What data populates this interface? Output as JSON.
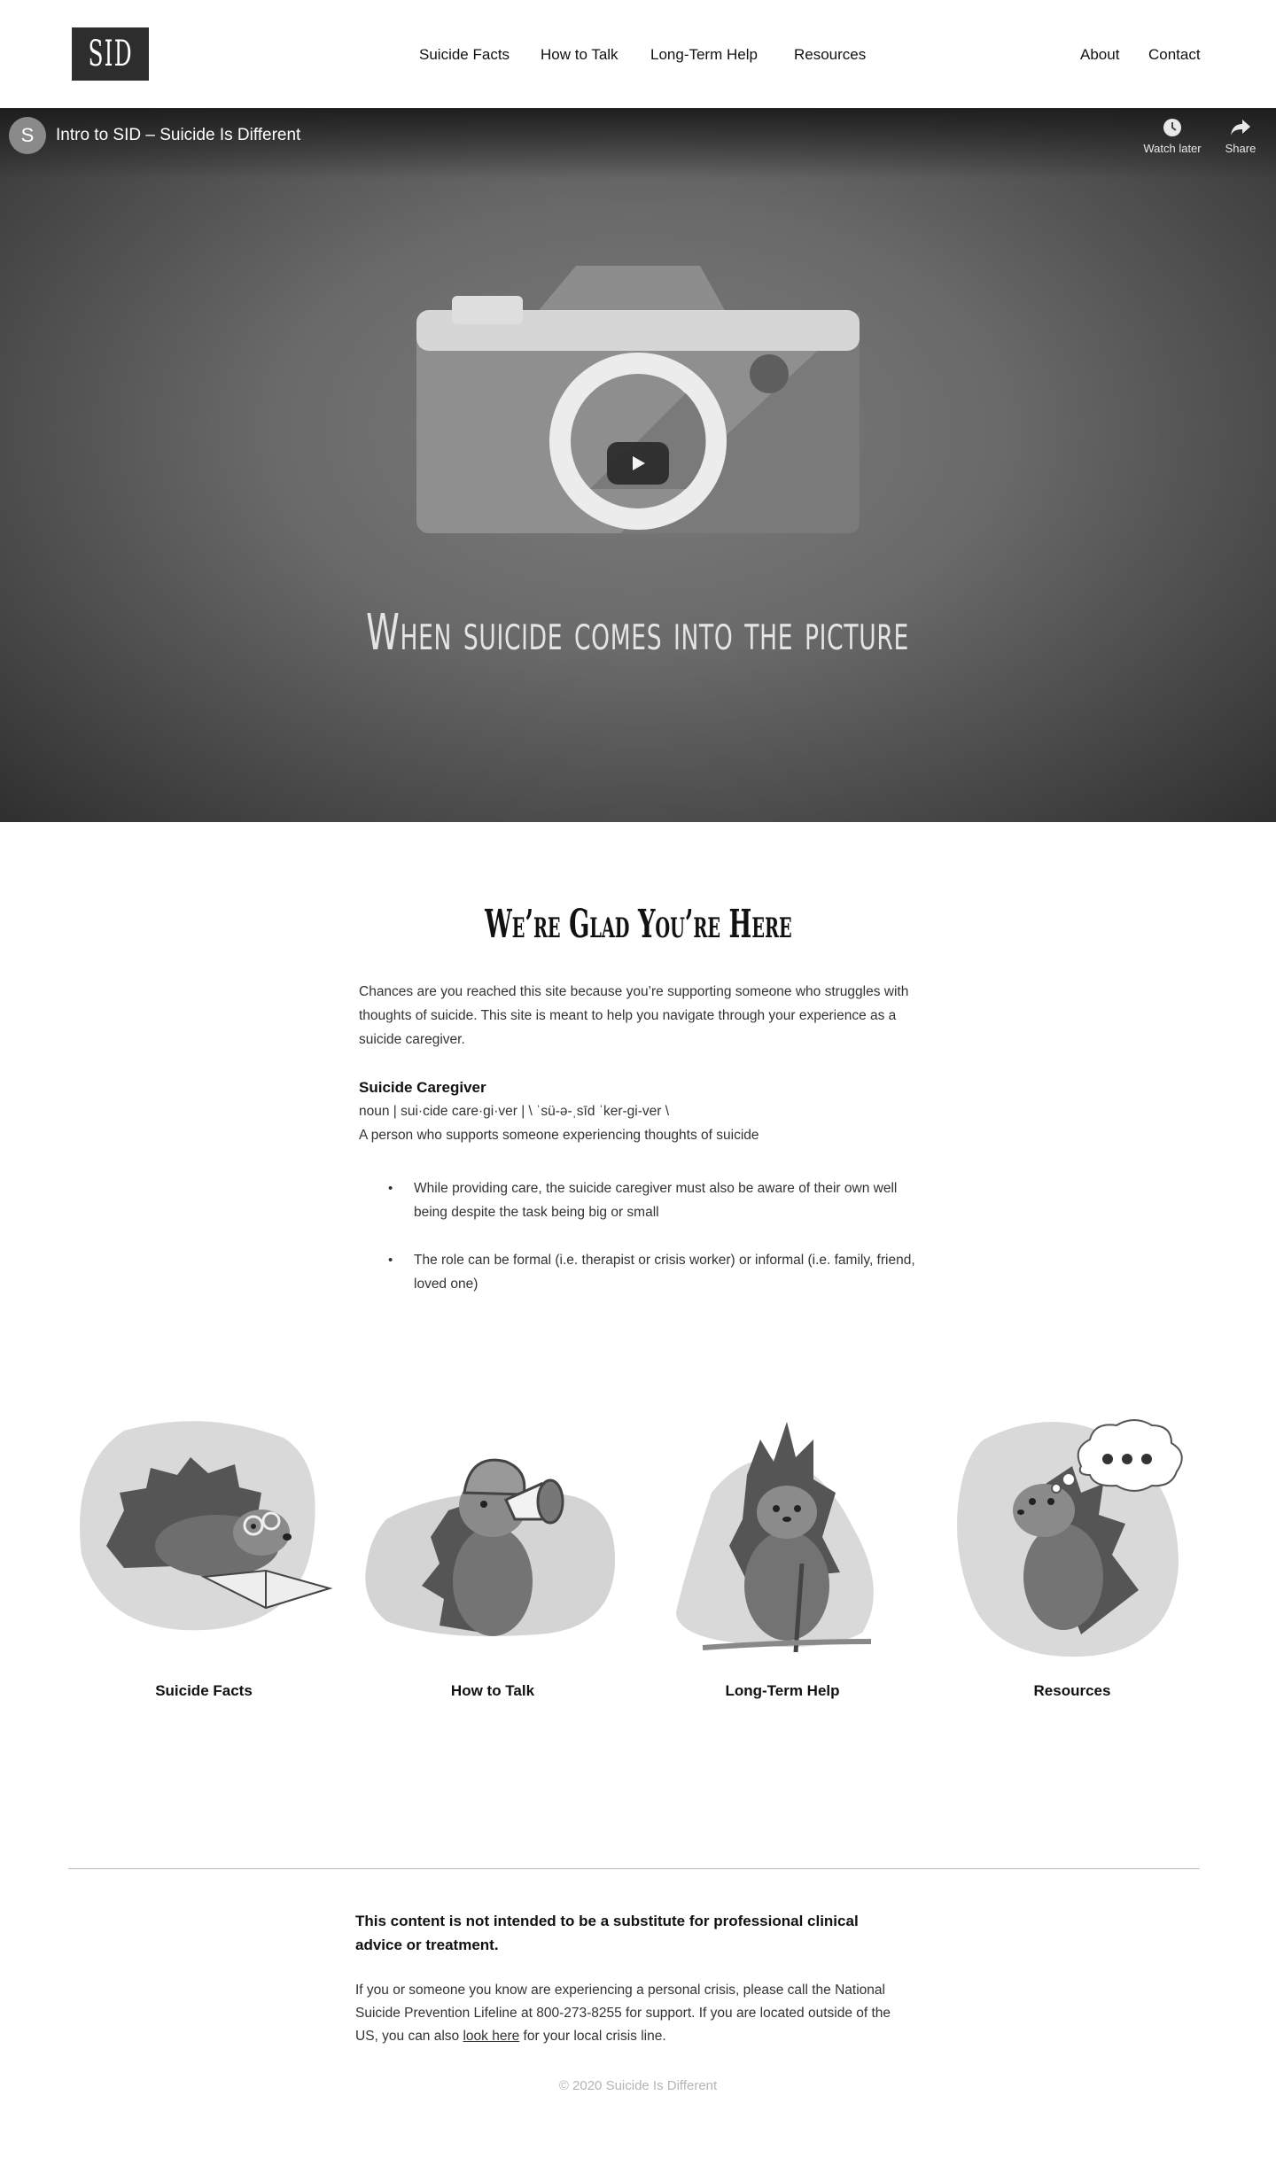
{
  "header": {
    "logo_text": "SID",
    "nav_main": [
      "Suicide Facts",
      "How to Talk",
      "Long-Term Help",
      "Resources"
    ],
    "nav_secondary": [
      "About",
      "Contact"
    ]
  },
  "video": {
    "channel_initial": "S",
    "title": "Intro to SID – Suicide Is Different",
    "watch_later_label": "Watch later",
    "share_label": "Share",
    "caption": "When suicide comes into the picture"
  },
  "intro": {
    "heading": "We’re Glad You’re Here",
    "paragraph": "Chances are you reached this site because you’re supporting someone who struggles with thoughts of suicide. This site is meant to help you navigate through your experience as a suicide caregiver.",
    "definition_term": "Suicide Caregiver",
    "definition_pronunciation": "noun  |  sui·cide care·gi·ver  |  \\ ˈsü-ə-ˌsīd ˈker-gi-ver \\",
    "definition_text": "A person who supports someone experiencing thoughts of suicide",
    "bullets": [
      "While providing care, the suicide caregiver must also be aware of their own well being despite the task being big or small",
      "The role can be formal (i.e. therapist or crisis worker) or informal (i.e. family, friend, loved one)"
    ]
  },
  "cards": [
    {
      "label": "Suicide Facts",
      "icon": "porcupine-reading-icon"
    },
    {
      "label": "How to Talk",
      "icon": "porcupine-megaphone-icon"
    },
    {
      "label": "Long-Term Help",
      "icon": "porcupine-cane-icon"
    },
    {
      "label": "Resources",
      "icon": "porcupine-thinking-icon"
    }
  ],
  "footer": {
    "disclaimer": "This content is not intended to be a substitute for professional clinical advice or treatment.",
    "crisis_before_link": "If you or someone you know are experiencing a personal crisis, please call the National Suicide Prevention Lifeline at 800-273-8255 for support. If you are located outside of the US, you can also ",
    "crisis_link": "look here",
    "crisis_after_link": " for your local crisis line.",
    "copyright": "© 2020 Suicide Is Different"
  },
  "colors": {
    "logo_bg": "#2d2d2d",
    "blob": "#d9d9d9",
    "divider": "#bdbdbd",
    "copyright": "#b5b5b5"
  }
}
